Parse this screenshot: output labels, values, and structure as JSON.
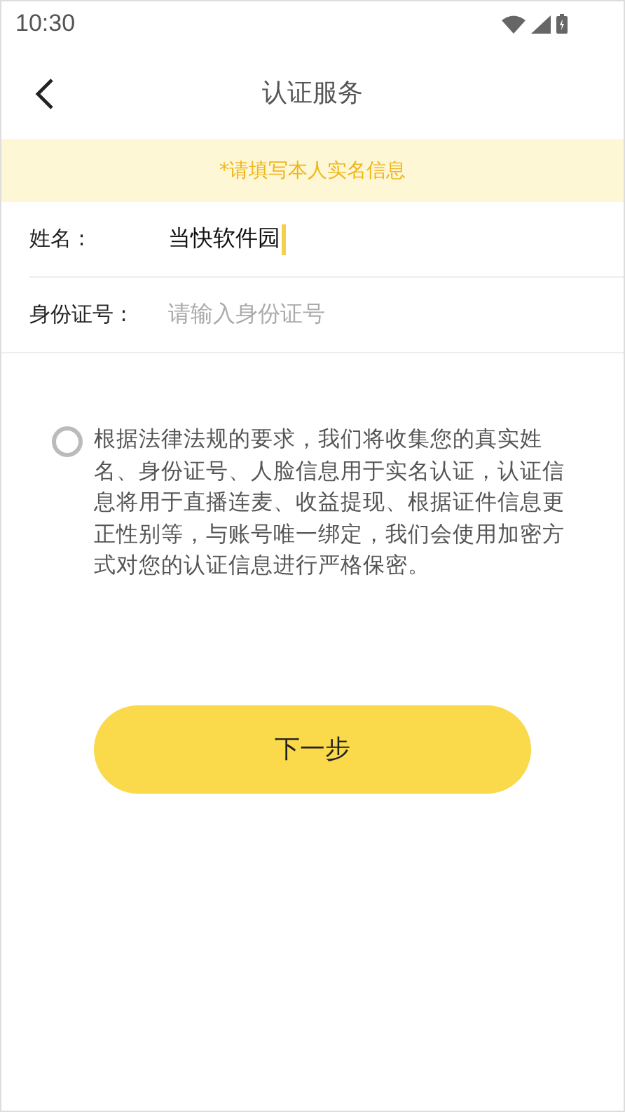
{
  "status_bar": {
    "time": "10:30"
  },
  "header": {
    "title": "认证服务"
  },
  "notice": "*请填写本人实名信息",
  "fields": [
    {
      "label": "姓名 :",
      "value": "当快软件园",
      "focused": true
    },
    {
      "label": "身份证号 :",
      "placeholder": "请输入身份证号",
      "focused": false
    }
  ],
  "agreement": {
    "checked": false,
    "text": "根据法律法规的要求，我们将收集您的真实姓名、身份证号、人脸信息用于实名认证，认证信息将用于直播连麦、收益提现、根据证件信息更正性别等，与账号唯一绑定，我们会使用加密方式对您的认证信息进行严格保密。"
  },
  "next_button": "下一步"
}
